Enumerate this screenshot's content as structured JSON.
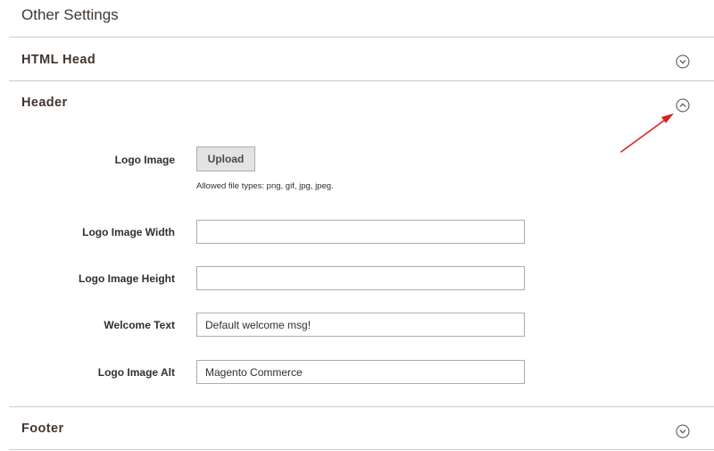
{
  "page": {
    "title": "Other Settings"
  },
  "sections": {
    "html_head": {
      "title": "HTML Head",
      "state": "collapsed",
      "icon": "chevron-down-icon"
    },
    "header": {
      "title": "Header",
      "state": "expanded",
      "icon": "chevron-up-icon"
    },
    "footer": {
      "title": "Footer",
      "state": "collapsed",
      "icon": "chevron-down-icon"
    }
  },
  "header_fields": {
    "logo_image": {
      "label": "Logo Image",
      "button_label": "Upload",
      "note": "Allowed file types: png, gif, jpg, jpeg."
    },
    "logo_width": {
      "label": "Logo Image Width",
      "value": ""
    },
    "logo_height": {
      "label": "Logo Image Height",
      "value": ""
    },
    "welcome_text": {
      "label": "Welcome Text",
      "value": "Default welcome msg!"
    },
    "logo_alt": {
      "label": "Logo Image Alt",
      "value": "Magento Commerce"
    }
  },
  "annotation": {
    "arrow_color": "#e02020",
    "arrow_icon": "red-arrow-pointer"
  },
  "colors": {
    "divider": "#cccccc",
    "title_text": "#41362f",
    "button_bg": "#e3e3e3",
    "input_border": "#adadad"
  }
}
